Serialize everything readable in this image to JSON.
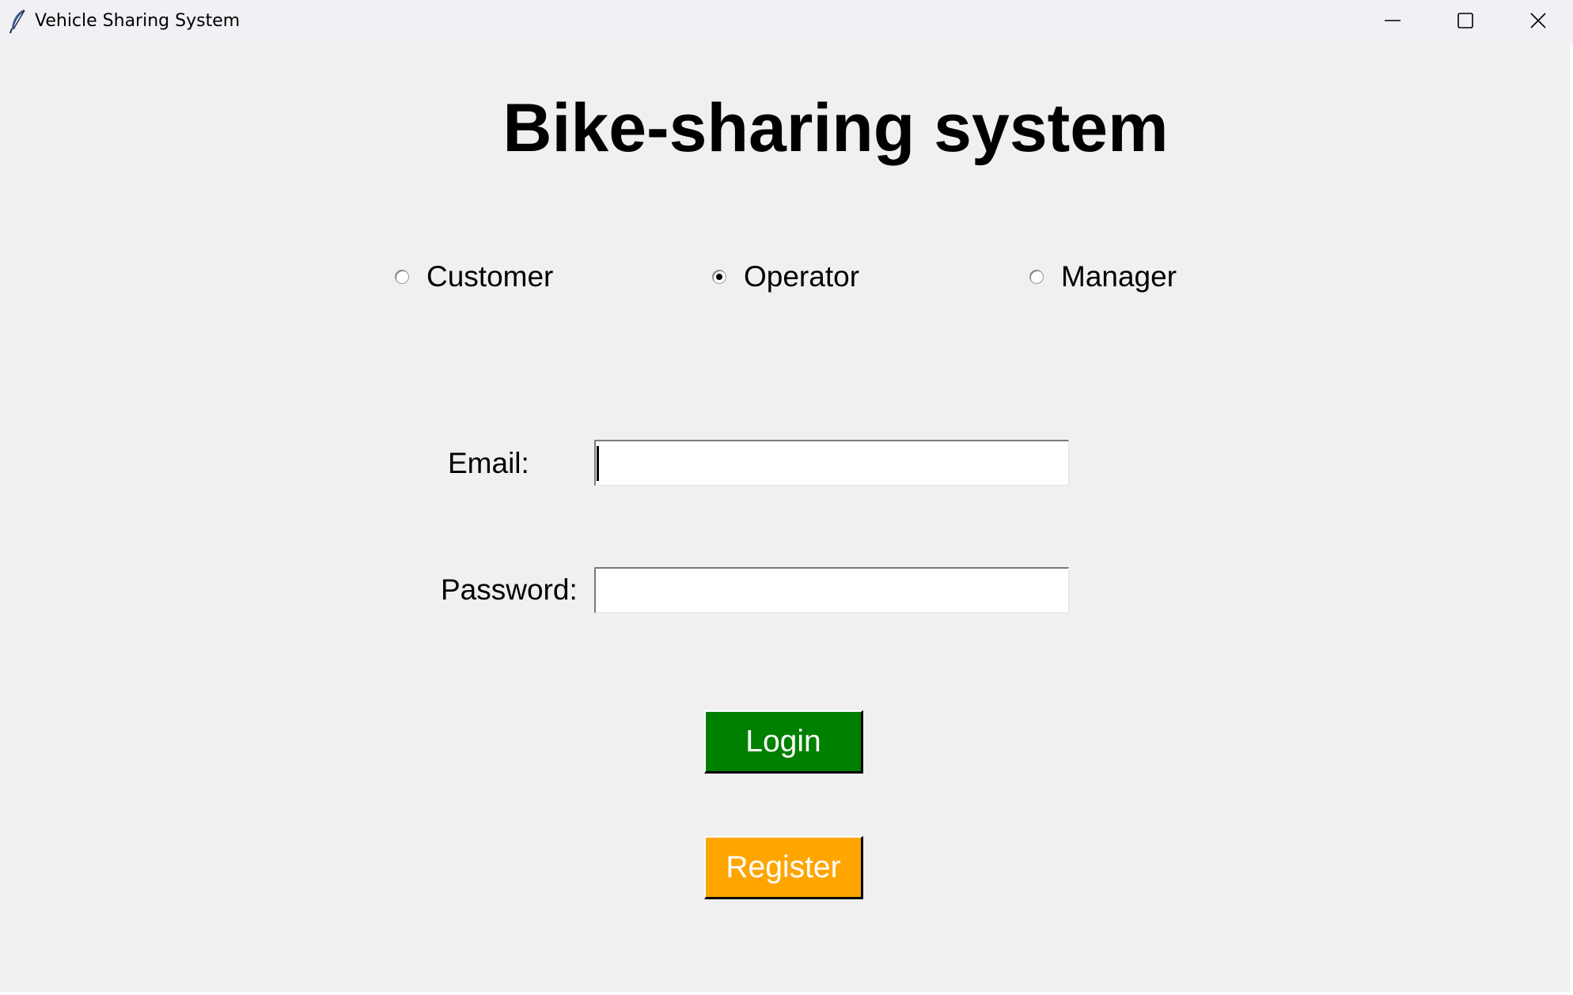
{
  "window": {
    "title": "Vehicle Sharing System",
    "controls": {
      "minimize": "minimize-icon",
      "maximize": "maximize-icon",
      "close": "close-icon"
    }
  },
  "main": {
    "heading": "Bike-sharing system",
    "roles": [
      {
        "label": "Customer",
        "selected": false
      },
      {
        "label": "Operator",
        "selected": true
      },
      {
        "label": "Manager",
        "selected": false
      }
    ],
    "email": {
      "label": "Email:",
      "value": ""
    },
    "password": {
      "label": "Password:",
      "value": ""
    },
    "login_button": {
      "label": "Login",
      "color": "#008000"
    },
    "register_button": {
      "label": "Register",
      "color": "#ffa500"
    }
  },
  "colors": {
    "background": "#f0f0f0",
    "titlebar": "#f3f0f5",
    "login": "#008000",
    "register": "#ffa500"
  }
}
